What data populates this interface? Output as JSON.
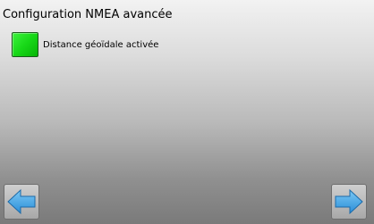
{
  "screen": {
    "title": "Configuration NMEA avancée"
  },
  "options": {
    "geoidal_distance": {
      "label": "Distance géoïdale activée",
      "checked": true,
      "color": "#22d622"
    }
  },
  "navigation": {
    "prev_icon": "arrow-left-icon",
    "next_icon": "arrow-right-icon",
    "accent_color": "#3ea3e6"
  }
}
